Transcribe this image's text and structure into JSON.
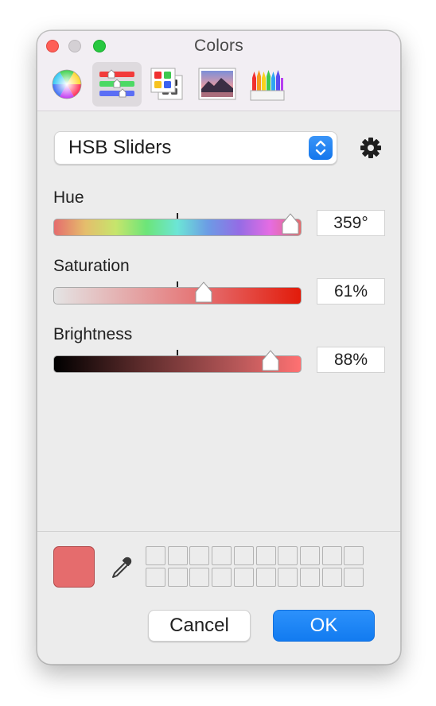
{
  "window": {
    "title": "Colors"
  },
  "toolbar": {
    "tools": [
      {
        "name": "color-wheel",
        "selected": false
      },
      {
        "name": "color-sliders",
        "selected": true
      },
      {
        "name": "color-palettes",
        "selected": false
      },
      {
        "name": "image-palettes",
        "selected": false
      },
      {
        "name": "pencils",
        "selected": false
      }
    ]
  },
  "mode_popup": {
    "selected": "HSB Sliders"
  },
  "sliders": [
    {
      "label": "Hue",
      "value_text": "359°",
      "value": 359,
      "max": 360
    },
    {
      "label": "Saturation",
      "value_text": "61%",
      "value": 61,
      "max": 100
    },
    {
      "label": "Brightness",
      "value_text": "88%",
      "value": 88,
      "max": 100
    }
  ],
  "current_color": "#e56c6d",
  "icons": {
    "gear": "gear-icon",
    "eyedropper": "eyedropper-icon",
    "popup_arrows": "chevron-up-down-icon"
  },
  "buttons": {
    "cancel": "Cancel",
    "ok": "OK"
  },
  "colors": {
    "accent": "#127bf0",
    "swatch_border": "#b24a4b"
  }
}
